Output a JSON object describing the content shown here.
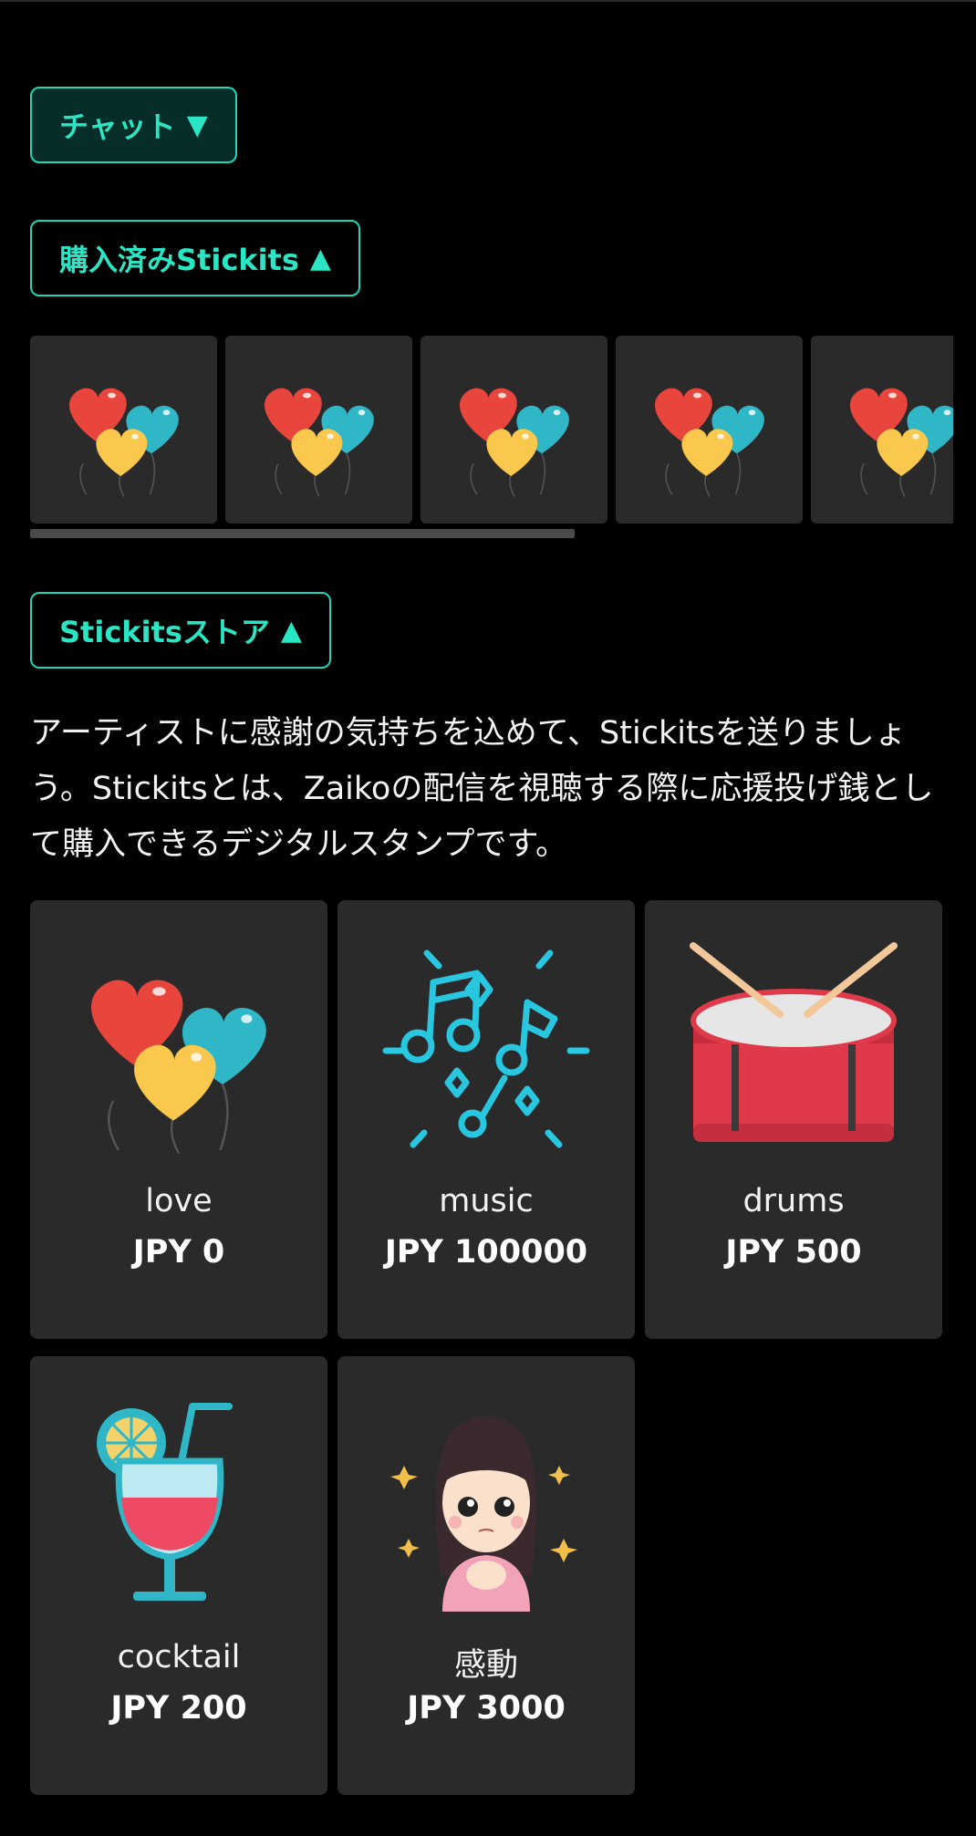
{
  "chat_toggle": {
    "label": "チャット",
    "caret": "▼"
  },
  "purchased_toggle": {
    "label": "購入済みStickits",
    "caret": "▲"
  },
  "purchased_items": [
    "balloons-icon",
    "balloons-icon",
    "balloons-icon",
    "balloons-icon",
    "balloons-icon"
  ],
  "store_toggle": {
    "label": "Stickitsストア",
    "caret": "▲"
  },
  "store_description": "アーティストに感謝の気持ちを込めて、Stickitsを送りましょう。Stickitsとは、Zaikoの配信を視聴する際に応援投げ銭として購入できるデジタルスタンプです。",
  "store_items": [
    {
      "name": "love",
      "price": "JPY 0",
      "icon": "balloons-icon"
    },
    {
      "name": "music",
      "price": "JPY 100000",
      "icon": "music-notes-icon"
    },
    {
      "name": "drums",
      "price": "JPY 500",
      "icon": "drum-icon"
    },
    {
      "name": "cocktail",
      "price": "JPY 200",
      "icon": "cocktail-icon"
    },
    {
      "name": "感動",
      "price": "JPY 3000",
      "icon": "moved-girl-icon"
    }
  ],
  "colors": {
    "accent": "#2be6c4",
    "background": "#000000",
    "card": "#2a2a2a"
  }
}
